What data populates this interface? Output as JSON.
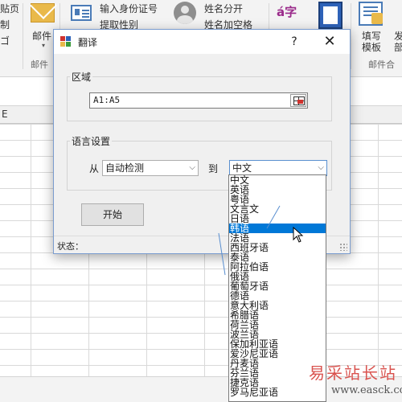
{
  "ribbon": {
    "cut_text": "贴页",
    "copy_text": "制",
    "extra_left_text": "ゴ",
    "mail_label": "邮件",
    "mail_group": "邮件",
    "id_input_label": "输入身份证号",
    "extract_gender_label": "提取性别",
    "name_split_label": "姓名分开",
    "name_space_label": "姓名加空格",
    "fill_template_line1": "填写",
    "fill_template_line2": "模板",
    "far_right_top": "发",
    "far_right_bottom": "部",
    "merge_group": "邮件合",
    "lang_icon_glyph": "á字"
  },
  "sheet": {
    "column_letter": "E"
  },
  "dialog": {
    "title": "翻译",
    "help": "?",
    "close": "✕",
    "region_group": "区域",
    "range_value": "A1:A5",
    "language_group": "语言设置",
    "from_label": "从",
    "source_language": "自动检测",
    "to_label": "到",
    "target_language": "中文",
    "start_button": "开始",
    "status_label": "状态："
  },
  "dropdown": {
    "selected_index": 5,
    "options": [
      "中文",
      "英语",
      "粤语",
      "文言文",
      "日语",
      "韩语",
      "法语",
      "西班牙语",
      "泰语",
      "阿拉伯语",
      "俄语",
      "葡萄牙语",
      "德语",
      "意大利语",
      "希腊语",
      "荷兰语",
      "波兰语",
      "保加利亚语",
      "爱沙尼亚语",
      "丹麦语",
      "芬兰语",
      "捷克语",
      "罗马尼亚语"
    ]
  },
  "watermark": {
    "title": "易采站长站",
    "url": "www.easck.com"
  },
  "colors": {
    "selection": "#0078d7",
    "dialog_bg": "#f0f0f0",
    "watermark": "#d9534f"
  }
}
